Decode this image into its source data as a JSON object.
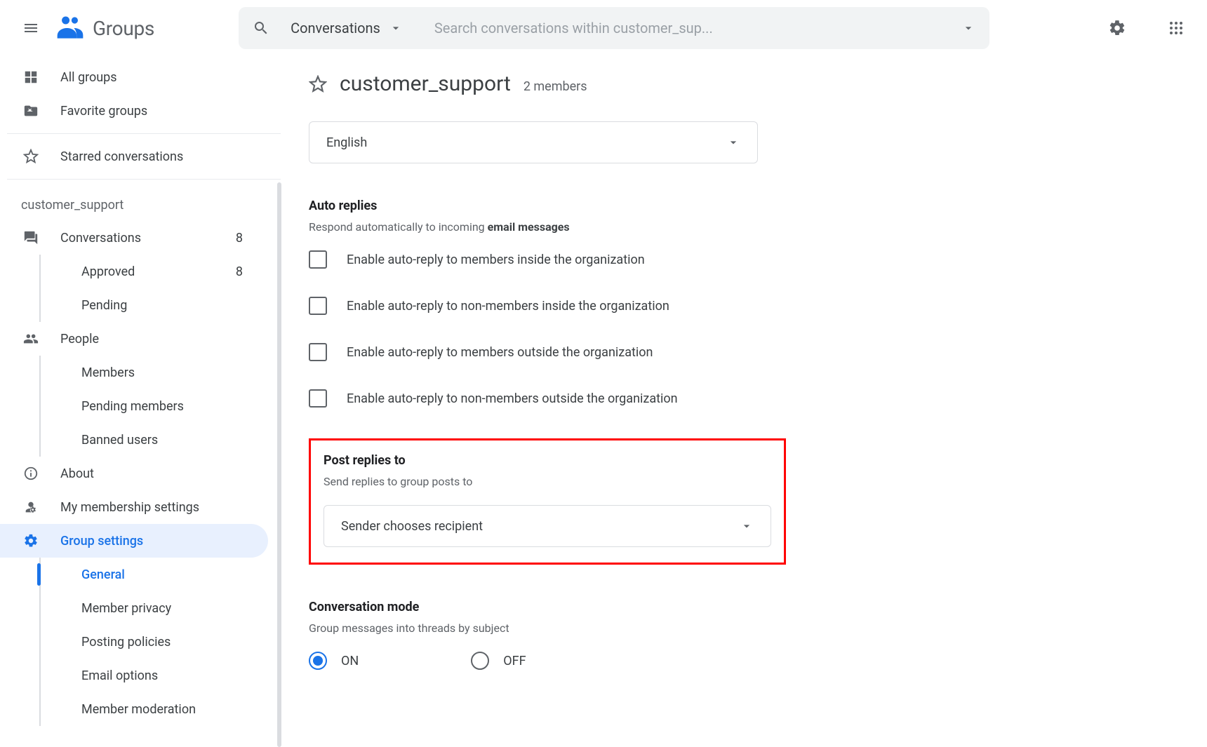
{
  "brand": {
    "name": "Groups"
  },
  "search": {
    "scope": "Conversations",
    "placeholder": "Search conversations within customer_sup..."
  },
  "sidebar_top": {
    "all_groups": "All groups",
    "favorite_groups": "Favorite groups",
    "starred_conversations": "Starred conversations"
  },
  "group_label": "customer_support",
  "sidebar_group": {
    "conversations": {
      "label": "Conversations",
      "count": "8"
    },
    "approved": {
      "label": "Approved",
      "count": "8"
    },
    "pending": {
      "label": "Pending"
    },
    "people": {
      "label": "People"
    },
    "members": {
      "label": "Members"
    },
    "pending_members": {
      "label": "Pending members"
    },
    "banned_users": {
      "label": "Banned users"
    },
    "about": {
      "label": "About"
    },
    "my_membership": {
      "label": "My membership settings"
    },
    "group_settings": {
      "label": "Group settings"
    },
    "gs_general": {
      "label": "General"
    },
    "gs_member_privacy": {
      "label": "Member privacy"
    },
    "gs_posting_policies": {
      "label": "Posting policies"
    },
    "gs_email_options": {
      "label": "Email options"
    },
    "gs_member_moderation": {
      "label": "Member moderation"
    }
  },
  "main": {
    "title": "customer_support",
    "members": "2 members",
    "language_select": "English",
    "auto_replies": {
      "title": "Auto replies",
      "subtitle_pre": "Respond automatically to incoming ",
      "subtitle_bold": "email messages",
      "options": {
        "members_inside": "Enable auto-reply to members inside the organization",
        "nonmembers_inside": "Enable auto-reply to non-members inside the organization",
        "members_outside": "Enable auto-reply to members outside the organization",
        "nonmembers_outside": "Enable auto-reply to non-members outside the organization"
      }
    },
    "post_replies": {
      "title": "Post replies to",
      "subtitle": "Send replies to group posts to",
      "value": "Sender chooses recipient"
    },
    "conversation_mode": {
      "title": "Conversation mode",
      "subtitle": "Group messages into threads by subject",
      "on": "ON",
      "off": "OFF"
    }
  }
}
